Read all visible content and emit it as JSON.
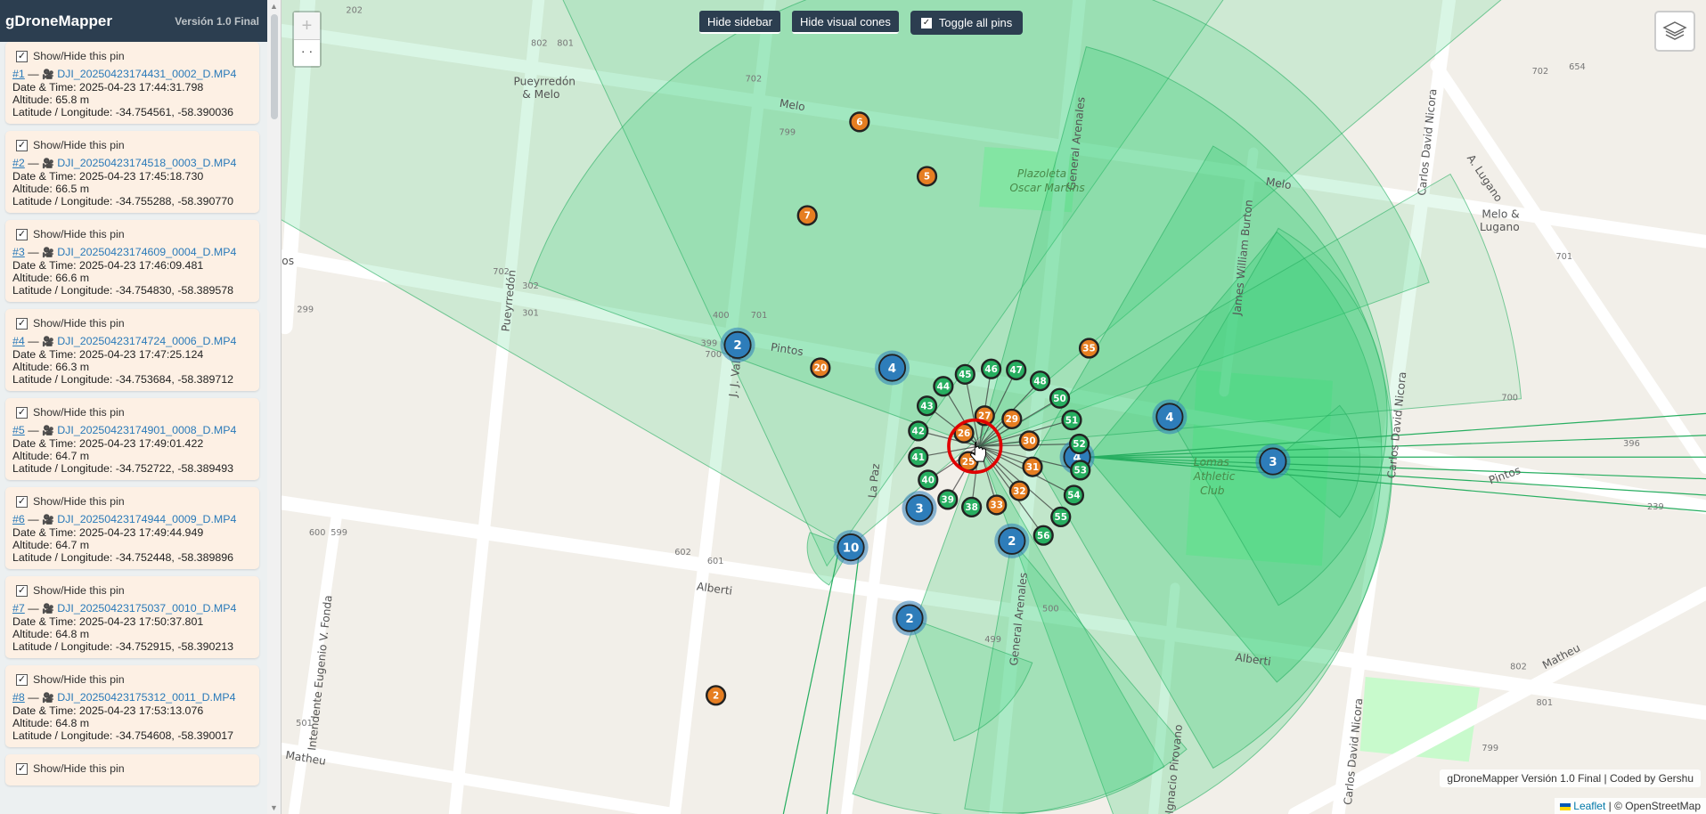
{
  "sidebar": {
    "title": "gDroneMapper",
    "version": "Versión 1.0 Final",
    "show_hide_label": "Show/Hide this pin",
    "pins": [
      {
        "num": "#1",
        "file": "DJI_20250423174431_0002_D.MP4",
        "datetime": "Date & Time: 2025-04-23 17:44:31.798",
        "altitude": "Altitude: 65.8 m",
        "latlon": "Latitude / Longitude: -34.754561, -58.390036"
      },
      {
        "num": "#2",
        "file": "DJI_20250423174518_0003_D.MP4",
        "datetime": "Date & Time: 2025-04-23 17:45:18.730",
        "altitude": "Altitude: 66.5 m",
        "latlon": "Latitude / Longitude: -34.755288, -58.390770"
      },
      {
        "num": "#3",
        "file": "DJI_20250423174609_0004_D.MP4",
        "datetime": "Date & Time: 2025-04-23 17:46:09.481",
        "altitude": "Altitude: 66.6 m",
        "latlon": "Latitude / Longitude: -34.754830, -58.389578"
      },
      {
        "num": "#4",
        "file": "DJI_20250423174724_0006_D.MP4",
        "datetime": "Date & Time: 2025-04-23 17:47:25.124",
        "altitude": "Altitude: 66.3 m",
        "latlon": "Latitude / Longitude: -34.753684, -58.389712"
      },
      {
        "num": "#5",
        "file": "DJI_20250423174901_0008_D.MP4",
        "datetime": "Date & Time: 2025-04-23 17:49:01.422",
        "altitude": "Altitude: 64.7 m",
        "latlon": "Latitude / Longitude: -34.752722, -58.389493"
      },
      {
        "num": "#6",
        "file": "DJI_20250423174944_0009_D.MP4",
        "datetime": "Date & Time: 2025-04-23 17:49:44.949",
        "altitude": "Altitude: 64.7 m",
        "latlon": "Latitude / Longitude: -34.752448, -58.389896"
      },
      {
        "num": "#7",
        "file": "DJI_20250423175037_0010_D.MP4",
        "datetime": "Date & Time: 2025-04-23 17:50:37.801",
        "altitude": "Altitude: 64.8 m",
        "latlon": "Latitude / Longitude: -34.752915, -58.390213"
      },
      {
        "num": "#8",
        "file": "DJI_20250423175312_0011_D.MP4",
        "datetime": "Date & Time: 2025-04-23 17:53:13.076",
        "altitude": "Altitude: 64.8 m",
        "latlon": "Latitude / Longitude: -34.754608, -58.390017"
      }
    ]
  },
  "toolbar": {
    "hide_sidebar": "Hide sidebar",
    "hide_cones": "Hide visual cones",
    "toggle_pins": "Toggle all pins"
  },
  "zoom": {
    "in": "+",
    "out": "· ·"
  },
  "attribution": {
    "app": "gDroneMapper Versión 1.0 Final | Coded by Gershu",
    "leaflet": "Leaflet",
    "osm": "| © OpenStreetMap"
  },
  "map": {
    "labels": [
      "Pintos",
      "Pintos",
      "Alberti",
      "Alberti",
      "Melo",
      "Melo",
      "Matheu",
      "Matheu",
      "Pueyrredón",
      "J. J. Valle",
      "La Paz",
      "General Arenales",
      "General Arenales",
      "Carlos David Nicora",
      "Carlos David Nicora",
      "Carlos David Nicora",
      "James William Burton",
      "Intendente Eugenio V. Fonda",
      "Ignacio Pirovano",
      "A. Lugano",
      "Plazoleta",
      "Oscar Martins",
      "Lomas",
      "Athletic",
      "Club",
      "Pueyrredón",
      "& Melo",
      "Melo &",
      "Lugano",
      "os"
    ],
    "house_numbers": [
      "202",
      "801",
      "802",
      "702",
      "400",
      "399",
      "799",
      "700",
      "701",
      "702",
      "302",
      "301",
      "299",
      "600",
      "599",
      "602",
      "601",
      "500",
      "499",
      "501",
      "700",
      "702",
      "701",
      "802",
      "801",
      "799",
      "654",
      "396",
      "239"
    ],
    "clusters": [
      "2",
      "4",
      "3",
      "10",
      "2",
      "2",
      "4",
      "3",
      "4"
    ],
    "orange_pins": [
      "6",
      "5",
      "7",
      "20",
      "35",
      "2",
      "26",
      "27",
      "25",
      "29",
      "30",
      "31",
      "32",
      "33"
    ],
    "green_pins": [
      "45",
      "46",
      "47",
      "48",
      "50",
      "51",
      "52",
      "53",
      "54",
      "55",
      "56",
      "44",
      "43",
      "42",
      "41",
      "40",
      "39",
      "38"
    ],
    "colors": {
      "cluster": "#2e7dba",
      "orange": "#e67e22",
      "green": "#27ae60",
      "cone": "#2ecc71",
      "selection": "#e00000"
    }
  }
}
